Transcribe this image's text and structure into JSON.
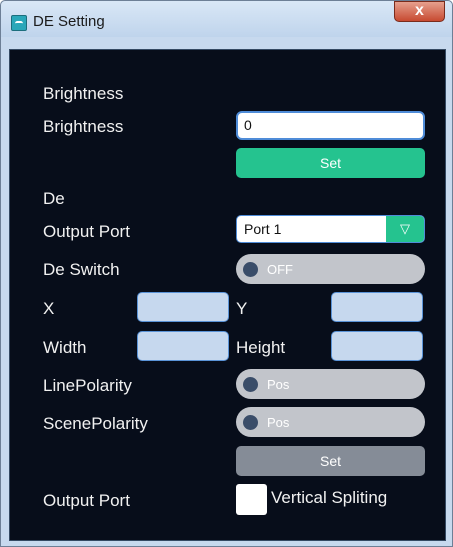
{
  "window": {
    "title": "DE Setting",
    "close_label": "x"
  },
  "brightness": {
    "section_label": "Brightness",
    "field_label": "Brightness",
    "value": "0",
    "set_label": "Set"
  },
  "de": {
    "section_label": "De",
    "output_port_label": "Output Port",
    "output_port_value": "Port 1",
    "dropdown_arrow": "▽",
    "switch_label": "De Switch",
    "switch_state": "OFF",
    "x_label": "X",
    "y_label": "Y",
    "x_value": "",
    "y_value": "",
    "width_label": "Width",
    "height_label": "Height",
    "width_value": "",
    "height_value": "",
    "line_polarity_label": "LinePolarity",
    "line_polarity_state": "Pos",
    "scene_polarity_label": "ScenePolarity",
    "scene_polarity_state": "Pos",
    "set_label": "Set",
    "output_port_label_2": "Output Port",
    "vertical_spliting_label": "Vertical Spliting",
    "vertical_spliting_checked": false
  },
  "colors": {
    "accent": "#25c38f",
    "panel_bg": "#070d1a",
    "toggle_bg": "#c2c5cb",
    "button_gray": "#858c97"
  }
}
